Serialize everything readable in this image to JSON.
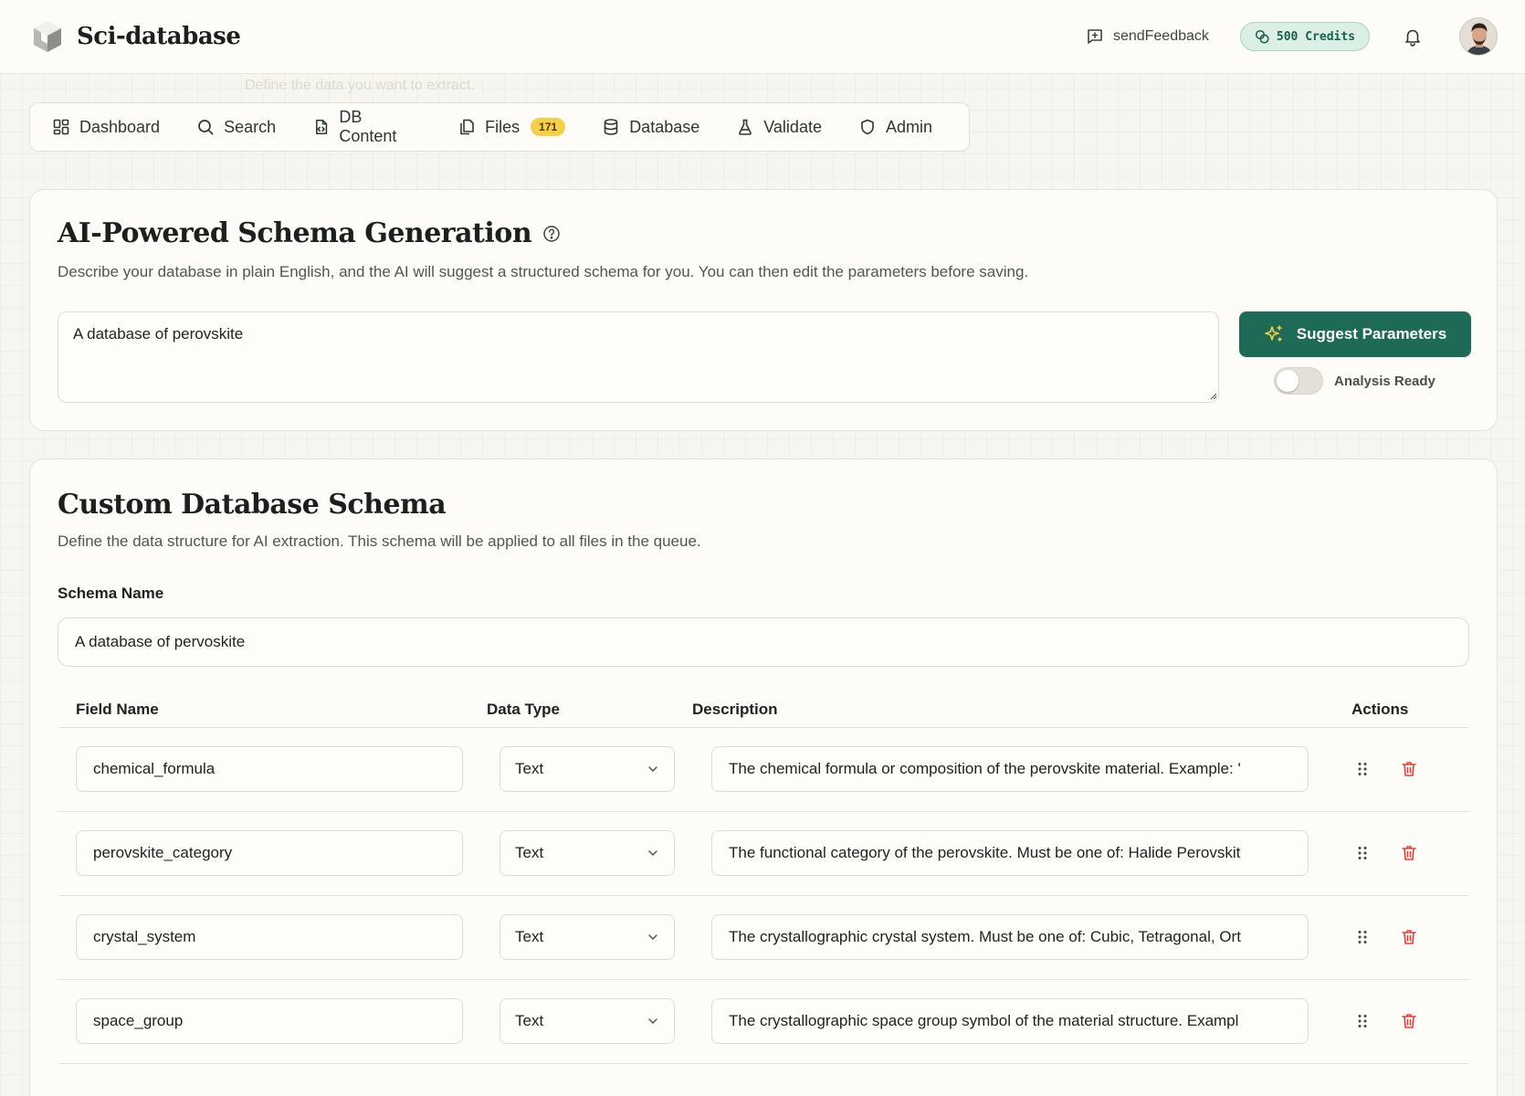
{
  "header": {
    "app_name": "Sci-database",
    "feedback_label": "sendFeedback",
    "credits_label": "500 Credits"
  },
  "ghost_text": "Define the data you want to extract.",
  "nav": {
    "items": [
      {
        "label": "Dashboard",
        "icon": "grid-icon"
      },
      {
        "label": "Search",
        "icon": "search-icon"
      },
      {
        "label": "DB Content",
        "icon": "file-code-icon"
      },
      {
        "label": "Files",
        "icon": "files-icon",
        "badge": "171"
      },
      {
        "label": "Database",
        "icon": "database-icon"
      },
      {
        "label": "Validate",
        "icon": "flask-icon"
      },
      {
        "label": "Admin",
        "icon": "shield-icon"
      }
    ]
  },
  "ai_section": {
    "title": "AI-Powered Schema Generation",
    "description": "Describe your database in plain English, and the AI will suggest a structured schema for you. You can then edit the parameters before saving.",
    "prompt_value": "A database of perovskite",
    "suggest_label": "Suggest Parameters",
    "toggle_label": "Analysis Ready",
    "toggle_on": false
  },
  "schema_section": {
    "title": "Custom Database Schema",
    "description": "Define the data structure for AI extraction. This schema will be applied to all files in the queue.",
    "schema_name_label": "Schema Name",
    "schema_name_value": "A database of pervoskite",
    "columns": {
      "field_name": "Field Name",
      "data_type": "Data Type",
      "description": "Description",
      "actions": "Actions"
    },
    "rows": [
      {
        "field": "chemical_formula",
        "type": "Text",
        "description": "The chemical formula or composition of the perovskite material. Example: '"
      },
      {
        "field": "perovskite_category",
        "type": "Text",
        "description": "The functional category of the perovskite. Must be one of: Halide Perovskit"
      },
      {
        "field": "crystal_system",
        "type": "Text",
        "description": "The crystallographic crystal system. Must be one of: Cubic, Tetragonal, Ort"
      },
      {
        "field": "space_group",
        "type": "Text",
        "description": "The crystallographic space group symbol of the material structure. Exampl"
      }
    ]
  },
  "colors": {
    "accent": "#1d6b56",
    "badge": "#f5cf45",
    "danger": "#e0413a"
  }
}
